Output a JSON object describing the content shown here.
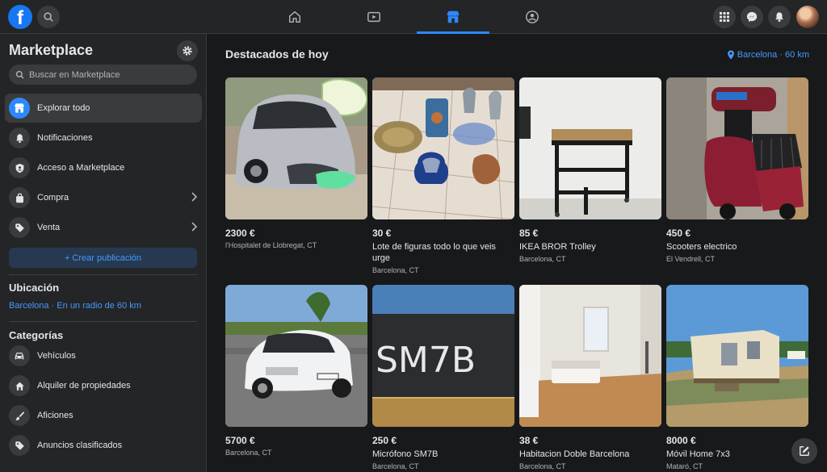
{
  "header": {
    "logo_letter": "f",
    "nav_tabs": [
      "home",
      "watch",
      "marketplace",
      "groups"
    ],
    "active_tab": "marketplace"
  },
  "sidebar": {
    "title": "Marketplace",
    "search_placeholder": "Buscar en Marketplace",
    "items": [
      {
        "label": "Explorar todo",
        "icon": "storefront-icon",
        "active": true
      },
      {
        "label": "Notificaciones",
        "icon": "bell-icon"
      },
      {
        "label": "Acceso a Marketplace",
        "icon": "shield-icon"
      },
      {
        "label": "Compra",
        "icon": "shopping-bag-icon",
        "chevron": true
      },
      {
        "label": "Venta",
        "icon": "tag-icon",
        "chevron": true
      }
    ],
    "create_label": "+ Crear publicación",
    "location_title": "Ubicación",
    "location_value": "Barcelona · En un radio de 60 km",
    "categories_title": "Categorías",
    "categories": [
      {
        "label": "Vehículos",
        "icon": "car-icon"
      },
      {
        "label": "Alquiler de propiedades",
        "icon": "house-icon"
      },
      {
        "label": "Aficiones",
        "icon": "paint-icon"
      },
      {
        "label": "Anuncios clasificados",
        "icon": "tag-icon"
      }
    ]
  },
  "main": {
    "title": "Destacados de hoy",
    "location": "Barcelona · 60 km",
    "listings": [
      {
        "price": "2300 €",
        "title": "",
        "location": "l'Hospitalet de Llobregat, CT"
      },
      {
        "price": "30 €",
        "title": "Lote de figuras todo lo que veis urge",
        "location": "Barcelona, CT"
      },
      {
        "price": "85 €",
        "title": "IKEA BROR Trolley",
        "location": "Barcelona, CT"
      },
      {
        "price": "450 €",
        "title": "Scooters electrico",
        "location": "El Vendrell, CT"
      },
      {
        "price": "5700 €",
        "title": "",
        "location": "Barcelona, CT"
      },
      {
        "price": "250 €",
        "title": "Micrófono SM7B",
        "location": "Barcelona, CT"
      },
      {
        "price": "38 €",
        "title": "Habitacion Doble Barcelona",
        "location": "Barcelona, CT"
      },
      {
        "price": "8000 €",
        "title": "Móvil Home 7x3",
        "location": "Mataró, CT"
      }
    ],
    "mic_text": "SM7B"
  },
  "colors": {
    "accent": "#2d88ff",
    "background": "#18191a",
    "surface": "#242526"
  }
}
